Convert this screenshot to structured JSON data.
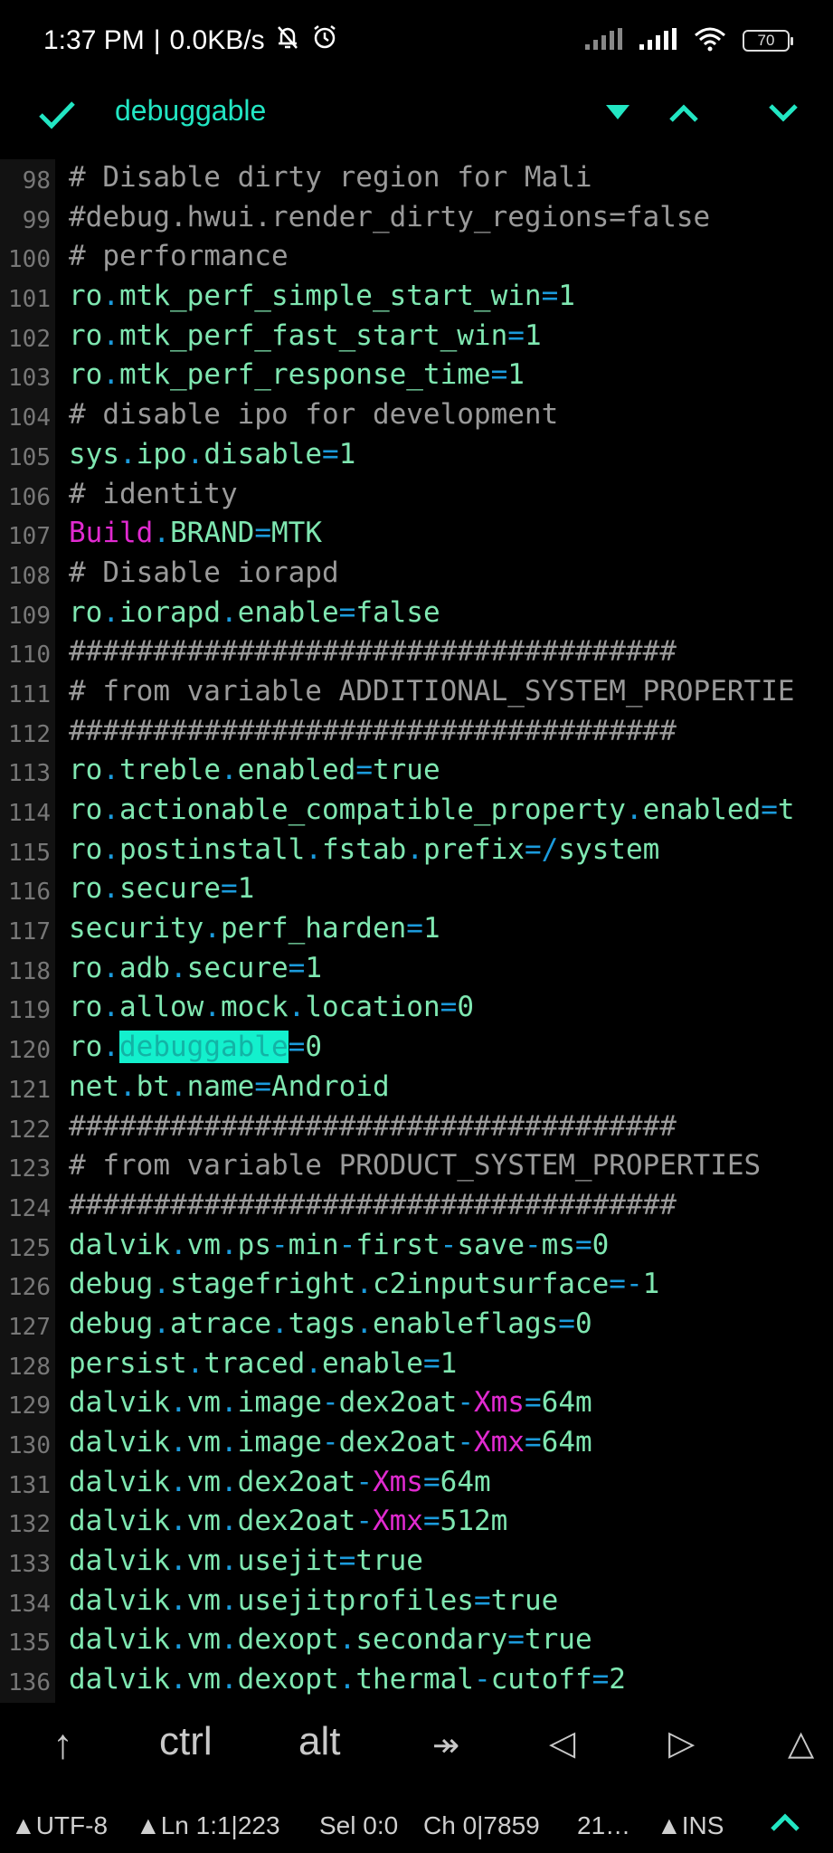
{
  "status_bar": {
    "time": "1:37 PM",
    "separator": "|",
    "net_speed": "0.0KB/s",
    "battery": "70"
  },
  "search": {
    "term": "debuggable"
  },
  "editor": {
    "lines": [
      {
        "n": "98",
        "tokens": [
          [
            "cmt",
            "# Disable dirty region for Mali"
          ]
        ]
      },
      {
        "n": "99",
        "tokens": [
          [
            "cmt",
            "#debug.hwui.render_dirty_regions=false"
          ]
        ]
      },
      {
        "n": "100",
        "tokens": [
          [
            "cmt",
            "# performance"
          ]
        ]
      },
      {
        "n": "101",
        "tokens": [
          [
            "id",
            "ro"
          ],
          [
            "op",
            "."
          ],
          [
            "id",
            "mtk_perf_simple_start_win"
          ],
          [
            "op",
            "="
          ],
          [
            "id",
            "1"
          ]
        ]
      },
      {
        "n": "102",
        "tokens": [
          [
            "id",
            "ro"
          ],
          [
            "op",
            "."
          ],
          [
            "id",
            "mtk_perf_fast_start_win"
          ],
          [
            "op",
            "="
          ],
          [
            "id",
            "1"
          ]
        ]
      },
      {
        "n": "103",
        "tokens": [
          [
            "id",
            "ro"
          ],
          [
            "op",
            "."
          ],
          [
            "id",
            "mtk_perf_response_time"
          ],
          [
            "op",
            "="
          ],
          [
            "id",
            "1"
          ]
        ]
      },
      {
        "n": "104",
        "tokens": [
          [
            "cmt",
            "# disable ipo for development"
          ]
        ]
      },
      {
        "n": "105",
        "tokens": [
          [
            "id",
            "sys"
          ],
          [
            "op",
            "."
          ],
          [
            "id",
            "ipo"
          ],
          [
            "op",
            "."
          ],
          [
            "id",
            "disable"
          ],
          [
            "op",
            "="
          ],
          [
            "id",
            "1"
          ]
        ]
      },
      {
        "n": "106",
        "tokens": [
          [
            "cmt",
            "# identity"
          ]
        ]
      },
      {
        "n": "107",
        "tokens": [
          [
            "mag",
            "Build"
          ],
          [
            "op",
            "."
          ],
          [
            "id",
            "BRAND"
          ],
          [
            "op",
            "="
          ],
          [
            "id",
            "MTK"
          ]
        ]
      },
      {
        "n": "108",
        "tokens": [
          [
            "cmt",
            "# Disable iorapd"
          ]
        ]
      },
      {
        "n": "109",
        "tokens": [
          [
            "id",
            "ro"
          ],
          [
            "op",
            "."
          ],
          [
            "id",
            "iorapd"
          ],
          [
            "op",
            "."
          ],
          [
            "id",
            "enable"
          ],
          [
            "op",
            "="
          ],
          [
            "id",
            "false"
          ]
        ]
      },
      {
        "n": "110",
        "tokens": [
          [
            "cmt",
            "####################################"
          ]
        ]
      },
      {
        "n": "111",
        "tokens": [
          [
            "cmt",
            "# from variable ADDITIONAL_SYSTEM_PROPERTIE"
          ]
        ]
      },
      {
        "n": "112",
        "tokens": [
          [
            "cmt",
            "####################################"
          ]
        ]
      },
      {
        "n": "113",
        "tokens": [
          [
            "id",
            "ro"
          ],
          [
            "op",
            "."
          ],
          [
            "id",
            "treble"
          ],
          [
            "op",
            "."
          ],
          [
            "id",
            "enabled"
          ],
          [
            "op",
            "="
          ],
          [
            "id",
            "true"
          ]
        ]
      },
      {
        "n": "114",
        "tokens": [
          [
            "id",
            "ro"
          ],
          [
            "op",
            "."
          ],
          [
            "id",
            "actionable_compatible_property"
          ],
          [
            "op",
            "."
          ],
          [
            "id",
            "enabled"
          ],
          [
            "op",
            "="
          ],
          [
            "id",
            "t"
          ]
        ]
      },
      {
        "n": "115",
        "tokens": [
          [
            "id",
            "ro"
          ],
          [
            "op",
            "."
          ],
          [
            "id",
            "postinstall"
          ],
          [
            "op",
            "."
          ],
          [
            "id",
            "fstab"
          ],
          [
            "op",
            "."
          ],
          [
            "id",
            "prefix"
          ],
          [
            "op",
            "=/"
          ],
          [
            "id",
            "system"
          ]
        ]
      },
      {
        "n": "116",
        "tokens": [
          [
            "id",
            "ro"
          ],
          [
            "op",
            "."
          ],
          [
            "id",
            "secure"
          ],
          [
            "op",
            "="
          ],
          [
            "id",
            "1"
          ]
        ]
      },
      {
        "n": "117",
        "tokens": [
          [
            "id",
            "security"
          ],
          [
            "op",
            "."
          ],
          [
            "id",
            "perf_harden"
          ],
          [
            "op",
            "="
          ],
          [
            "id",
            "1"
          ]
        ]
      },
      {
        "n": "118",
        "tokens": [
          [
            "id",
            "ro"
          ],
          [
            "op",
            "."
          ],
          [
            "id",
            "adb"
          ],
          [
            "op",
            "."
          ],
          [
            "id",
            "secure"
          ],
          [
            "op",
            "="
          ],
          [
            "id",
            "1"
          ]
        ]
      },
      {
        "n": "119",
        "tokens": [
          [
            "id",
            "ro"
          ],
          [
            "op",
            "."
          ],
          [
            "id",
            "allow"
          ],
          [
            "op",
            "."
          ],
          [
            "id",
            "mock"
          ],
          [
            "op",
            "."
          ],
          [
            "id",
            "location"
          ],
          [
            "op",
            "="
          ],
          [
            "id",
            "0"
          ]
        ]
      },
      {
        "n": "120",
        "tokens": [
          [
            "id",
            "ro"
          ],
          [
            "op",
            "."
          ],
          [
            "match",
            "debuggable"
          ],
          [
            "op",
            "="
          ],
          [
            "id",
            "0"
          ]
        ]
      },
      {
        "n": "121",
        "tokens": [
          [
            "id",
            "net"
          ],
          [
            "op",
            "."
          ],
          [
            "id",
            "bt"
          ],
          [
            "op",
            "."
          ],
          [
            "id",
            "name"
          ],
          [
            "op",
            "="
          ],
          [
            "id",
            "Android"
          ]
        ]
      },
      {
        "n": "122",
        "tokens": [
          [
            "cmt",
            "####################################"
          ]
        ]
      },
      {
        "n": "123",
        "tokens": [
          [
            "cmt",
            "# from variable PRODUCT_SYSTEM_PROPERTIES"
          ]
        ]
      },
      {
        "n": "124",
        "tokens": [
          [
            "cmt",
            "####################################"
          ]
        ]
      },
      {
        "n": "125",
        "tokens": [
          [
            "id",
            "dalvik"
          ],
          [
            "op",
            "."
          ],
          [
            "id",
            "vm"
          ],
          [
            "op",
            "."
          ],
          [
            "id",
            "ps"
          ],
          [
            "op",
            "-"
          ],
          [
            "id",
            "min"
          ],
          [
            "op",
            "-"
          ],
          [
            "id",
            "first"
          ],
          [
            "op",
            "-"
          ],
          [
            "id",
            "save"
          ],
          [
            "op",
            "-"
          ],
          [
            "id",
            "ms"
          ],
          [
            "op",
            "="
          ],
          [
            "id",
            "0"
          ]
        ]
      },
      {
        "n": "126",
        "tokens": [
          [
            "id",
            "debug"
          ],
          [
            "op",
            "."
          ],
          [
            "id",
            "stagefright"
          ],
          [
            "op",
            "."
          ],
          [
            "id",
            "c2inputsurface"
          ],
          [
            "op",
            "=-"
          ],
          [
            "id",
            "1"
          ]
        ]
      },
      {
        "n": "127",
        "tokens": [
          [
            "id",
            "debug"
          ],
          [
            "op",
            "."
          ],
          [
            "id",
            "atrace"
          ],
          [
            "op",
            "."
          ],
          [
            "id",
            "tags"
          ],
          [
            "op",
            "."
          ],
          [
            "id",
            "enableflags"
          ],
          [
            "op",
            "="
          ],
          [
            "id",
            "0"
          ]
        ]
      },
      {
        "n": "128",
        "tokens": [
          [
            "id",
            "persist"
          ],
          [
            "op",
            "."
          ],
          [
            "id",
            "traced"
          ],
          [
            "op",
            "."
          ],
          [
            "id",
            "enable"
          ],
          [
            "op",
            "="
          ],
          [
            "id",
            "1"
          ]
        ]
      },
      {
        "n": "129",
        "tokens": [
          [
            "id",
            "dalvik"
          ],
          [
            "op",
            "."
          ],
          [
            "id",
            "vm"
          ],
          [
            "op",
            "."
          ],
          [
            "id",
            "image"
          ],
          [
            "op",
            "-"
          ],
          [
            "id",
            "dex2oat"
          ],
          [
            "op",
            "-"
          ],
          [
            "mag",
            "Xms"
          ],
          [
            "op",
            "="
          ],
          [
            "id",
            "64m"
          ]
        ]
      },
      {
        "n": "130",
        "tokens": [
          [
            "id",
            "dalvik"
          ],
          [
            "op",
            "."
          ],
          [
            "id",
            "vm"
          ],
          [
            "op",
            "."
          ],
          [
            "id",
            "image"
          ],
          [
            "op",
            "-"
          ],
          [
            "id",
            "dex2oat"
          ],
          [
            "op",
            "-"
          ],
          [
            "mag",
            "Xmx"
          ],
          [
            "op",
            "="
          ],
          [
            "id",
            "64m"
          ]
        ]
      },
      {
        "n": "131",
        "tokens": [
          [
            "id",
            "dalvik"
          ],
          [
            "op",
            "."
          ],
          [
            "id",
            "vm"
          ],
          [
            "op",
            "."
          ],
          [
            "id",
            "dex2oat"
          ],
          [
            "op",
            "-"
          ],
          [
            "mag",
            "Xms"
          ],
          [
            "op",
            "="
          ],
          [
            "id",
            "64m"
          ]
        ]
      },
      {
        "n": "132",
        "tokens": [
          [
            "id",
            "dalvik"
          ],
          [
            "op",
            "."
          ],
          [
            "id",
            "vm"
          ],
          [
            "op",
            "."
          ],
          [
            "id",
            "dex2oat"
          ],
          [
            "op",
            "-"
          ],
          [
            "mag",
            "Xmx"
          ],
          [
            "op",
            "="
          ],
          [
            "id",
            "512m"
          ]
        ]
      },
      {
        "n": "133",
        "tokens": [
          [
            "id",
            "dalvik"
          ],
          [
            "op",
            "."
          ],
          [
            "id",
            "vm"
          ],
          [
            "op",
            "."
          ],
          [
            "id",
            "usejit"
          ],
          [
            "op",
            "="
          ],
          [
            "id",
            "true"
          ]
        ]
      },
      {
        "n": "134",
        "tokens": [
          [
            "id",
            "dalvik"
          ],
          [
            "op",
            "."
          ],
          [
            "id",
            "vm"
          ],
          [
            "op",
            "."
          ],
          [
            "id",
            "usejitprofiles"
          ],
          [
            "op",
            "="
          ],
          [
            "id",
            "true"
          ]
        ]
      },
      {
        "n": "135",
        "tokens": [
          [
            "id",
            "dalvik"
          ],
          [
            "op",
            "."
          ],
          [
            "id",
            "vm"
          ],
          [
            "op",
            "."
          ],
          [
            "id",
            "dexopt"
          ],
          [
            "op",
            "."
          ],
          [
            "id",
            "secondary"
          ],
          [
            "op",
            "="
          ],
          [
            "id",
            "true"
          ]
        ]
      },
      {
        "n": "136",
        "tokens": [
          [
            "id",
            "dalvik"
          ],
          [
            "op",
            "."
          ],
          [
            "id",
            "vm"
          ],
          [
            "op",
            "."
          ],
          [
            "id",
            "dexopt"
          ],
          [
            "op",
            "."
          ],
          [
            "id",
            "thermal"
          ],
          [
            "op",
            "-"
          ],
          [
            "id",
            "cutoff"
          ],
          [
            "op",
            "="
          ],
          [
            "id",
            "2"
          ]
        ]
      }
    ]
  },
  "keys": {
    "shift": "↑",
    "ctrl": "ctrl",
    "alt": "alt",
    "tab": "↠",
    "left": "◁",
    "right": "▷",
    "up": "△"
  },
  "footer": {
    "encoding": "▲UTF-8",
    "line_col": "▲Ln 1:1|223",
    "selection": "Sel 0:0",
    "char": "Ch 0|7859",
    "extra": "21…",
    "mode": "▲INS"
  },
  "colors": {
    "accent": "#22e6c3",
    "identifier": "#7fe7b1",
    "operator": "#1b9bdc",
    "keyword": "#e12ad0",
    "comment": "#9a9a9a"
  }
}
